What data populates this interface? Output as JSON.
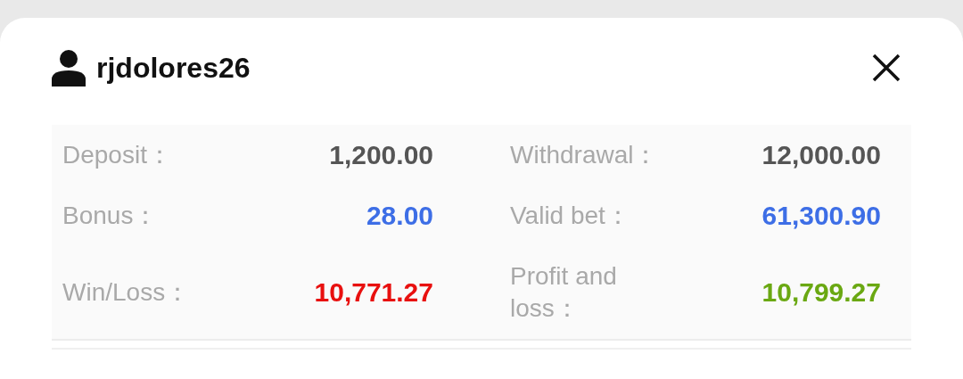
{
  "user": {
    "name": "rjdolores26"
  },
  "rows": [
    {
      "left": {
        "label": "Deposit：",
        "value": "1,200.00",
        "color": "#555555"
      },
      "right": {
        "label": "Withdrawal：",
        "value": "12,000.00",
        "color": "#555555"
      }
    },
    {
      "left": {
        "label": "Bonus：",
        "value": "28.00",
        "color": "#3d6ee6"
      },
      "right": {
        "label": "Valid bet：",
        "value": "61,300.90",
        "color": "#3d6ee6"
      }
    },
    {
      "left": {
        "label": "Win/Loss：",
        "value": "10,771.27",
        "color": "#e8100f"
      },
      "right": {
        "label": "Profit and loss：",
        "value": "10,799.27",
        "color": "#6aa812"
      }
    }
  ]
}
